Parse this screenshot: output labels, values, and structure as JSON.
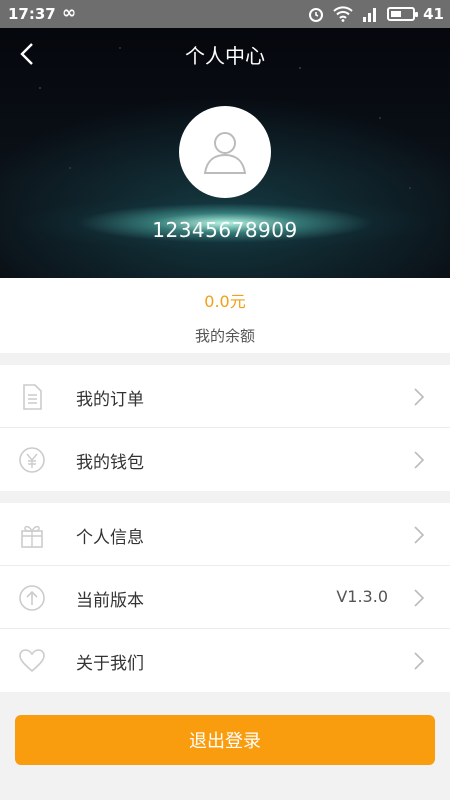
{
  "status_bar": {
    "time": "17:37",
    "infinity": "∞",
    "battery": "41"
  },
  "header": {
    "title": "个人中心",
    "phone": "12345678909"
  },
  "balance": {
    "amount": "0.0元",
    "label": "我的余额"
  },
  "menu_group1": [
    {
      "label": "我的订单",
      "icon": "document-icon"
    },
    {
      "label": "我的钱包",
      "icon": "yen-icon"
    }
  ],
  "menu_group2": [
    {
      "label": "个人信息",
      "icon": "gift-icon",
      "value": ""
    },
    {
      "label": "当前版本",
      "icon": "upload-icon",
      "value": "V1.3.0"
    },
    {
      "label": "关于我们",
      "icon": "heart-icon",
      "value": ""
    }
  ],
  "logout": {
    "label": "退出登录"
  },
  "colors": {
    "accent": "#f99c0d",
    "amount": "#f0a01a"
  }
}
